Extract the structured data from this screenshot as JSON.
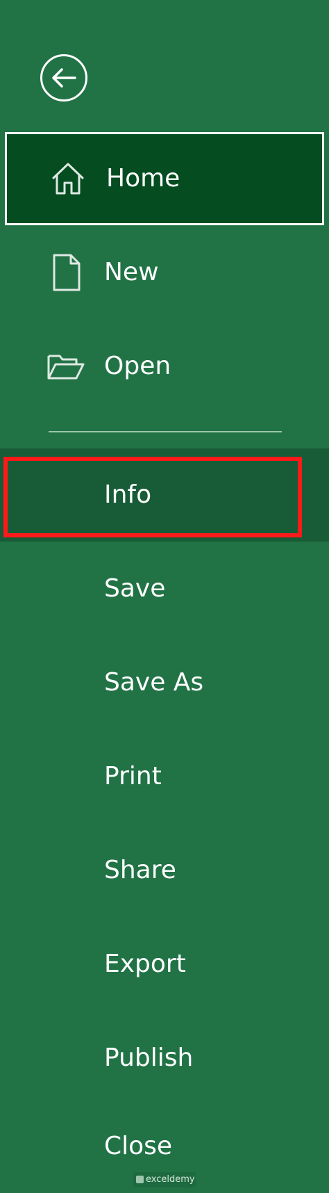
{
  "menu": {
    "back_icon": "back-arrow-icon",
    "items": [
      {
        "label": "Home",
        "icon": "home-icon",
        "selected": true
      },
      {
        "label": "New",
        "icon": "new-document-icon"
      },
      {
        "label": "Open",
        "icon": "open-folder-icon"
      },
      {
        "label": "Info",
        "highlighted": true
      },
      {
        "label": "Save"
      },
      {
        "label": "Save As"
      },
      {
        "label": "Print"
      },
      {
        "label": "Share"
      },
      {
        "label": "Export"
      },
      {
        "label": "Publish"
      },
      {
        "label": "Close"
      }
    ]
  },
  "watermark": {
    "text": "exceldemy"
  },
  "colors": {
    "background": "#217346",
    "selected": "#054d21",
    "info_row": "#185c37",
    "highlight_border": "#ff1a1a",
    "text": "#ffffff"
  }
}
